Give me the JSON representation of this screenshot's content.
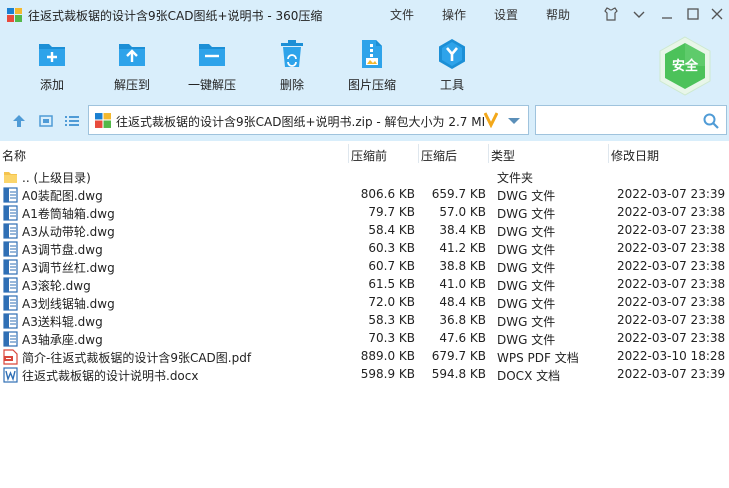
{
  "window": {
    "title": "往返式裁板锯的设计含9张CAD图纸+说明书 - 360压缩",
    "menu": [
      "文件",
      "操作",
      "设置",
      "帮助"
    ]
  },
  "toolbar": {
    "buttons": [
      {
        "label": "添加",
        "icon": "add-file-icon"
      },
      {
        "label": "解压到",
        "icon": "extract-to-icon"
      },
      {
        "label": "一键解压",
        "icon": "one-click-extract-icon"
      },
      {
        "label": "删除",
        "icon": "delete-icon"
      },
      {
        "label": "图片压缩",
        "icon": "image-compress-icon"
      },
      {
        "label": "工具",
        "icon": "tools-icon"
      }
    ],
    "safe_badge": "安全"
  },
  "address": {
    "path": "往返式裁板锯的设计含9张CAD图纸+说明书.zip - 解包大小为 2.7 MB",
    "search_placeholder": ""
  },
  "columns": {
    "name": "名称",
    "size": "压缩前",
    "compressed": "压缩后",
    "type": "类型",
    "date": "修改日期"
  },
  "files": [
    {
      "name": ".. (上级目录)",
      "size": "",
      "compressed": "",
      "type": "文件夹",
      "date": "",
      "icon": "folder-icon"
    },
    {
      "name": "A0装配图.dwg",
      "size": "806.6 KB",
      "compressed": "659.7 KB",
      "type": "DWG 文件",
      "date": "2022-03-07 23:39",
      "icon": "dwg-file-icon"
    },
    {
      "name": "A1卷筒轴箱.dwg",
      "size": "79.7 KB",
      "compressed": "57.0 KB",
      "type": "DWG 文件",
      "date": "2022-03-07 23:38",
      "icon": "dwg-file-icon"
    },
    {
      "name": "A3从动带轮.dwg",
      "size": "58.4 KB",
      "compressed": "38.4 KB",
      "type": "DWG 文件",
      "date": "2022-03-07 23:38",
      "icon": "dwg-file-icon"
    },
    {
      "name": "A3调节盘.dwg",
      "size": "60.3 KB",
      "compressed": "41.2 KB",
      "type": "DWG 文件",
      "date": "2022-03-07 23:38",
      "icon": "dwg-file-icon"
    },
    {
      "name": "A3调节丝杠.dwg",
      "size": "60.7 KB",
      "compressed": "38.8 KB",
      "type": "DWG 文件",
      "date": "2022-03-07 23:38",
      "icon": "dwg-file-icon"
    },
    {
      "name": "A3滚轮.dwg",
      "size": "61.5 KB",
      "compressed": "41.0 KB",
      "type": "DWG 文件",
      "date": "2022-03-07 23:38",
      "icon": "dwg-file-icon"
    },
    {
      "name": "A3划线锯轴.dwg",
      "size": "72.0 KB",
      "compressed": "48.4 KB",
      "type": "DWG 文件",
      "date": "2022-03-07 23:38",
      "icon": "dwg-file-icon"
    },
    {
      "name": "A3送料辊.dwg",
      "size": "58.3 KB",
      "compressed": "36.8 KB",
      "type": "DWG 文件",
      "date": "2022-03-07 23:38",
      "icon": "dwg-file-icon"
    },
    {
      "name": "A3轴承座.dwg",
      "size": "70.3 KB",
      "compressed": "47.6 KB",
      "type": "DWG 文件",
      "date": "2022-03-07 23:38",
      "icon": "dwg-file-icon"
    },
    {
      "name": "简介-往返式裁板锯的设计含9张CAD图.pdf",
      "size": "889.0 KB",
      "compressed": "679.7 KB",
      "type": "WPS PDF 文档",
      "date": "2022-03-10 18:28",
      "icon": "pdf-file-icon"
    },
    {
      "name": "往返式裁板锯的设计说明书.docx",
      "size": "598.9 KB",
      "compressed": "594.8 KB",
      "type": "DOCX 文档",
      "date": "2022-03-07 23:39",
      "icon": "docx-file-icon"
    }
  ],
  "colors": {
    "toolbar_bg": "#d9eefb",
    "accent_blue": "#1c8fd6",
    "safe_green": "#4cc25a"
  }
}
